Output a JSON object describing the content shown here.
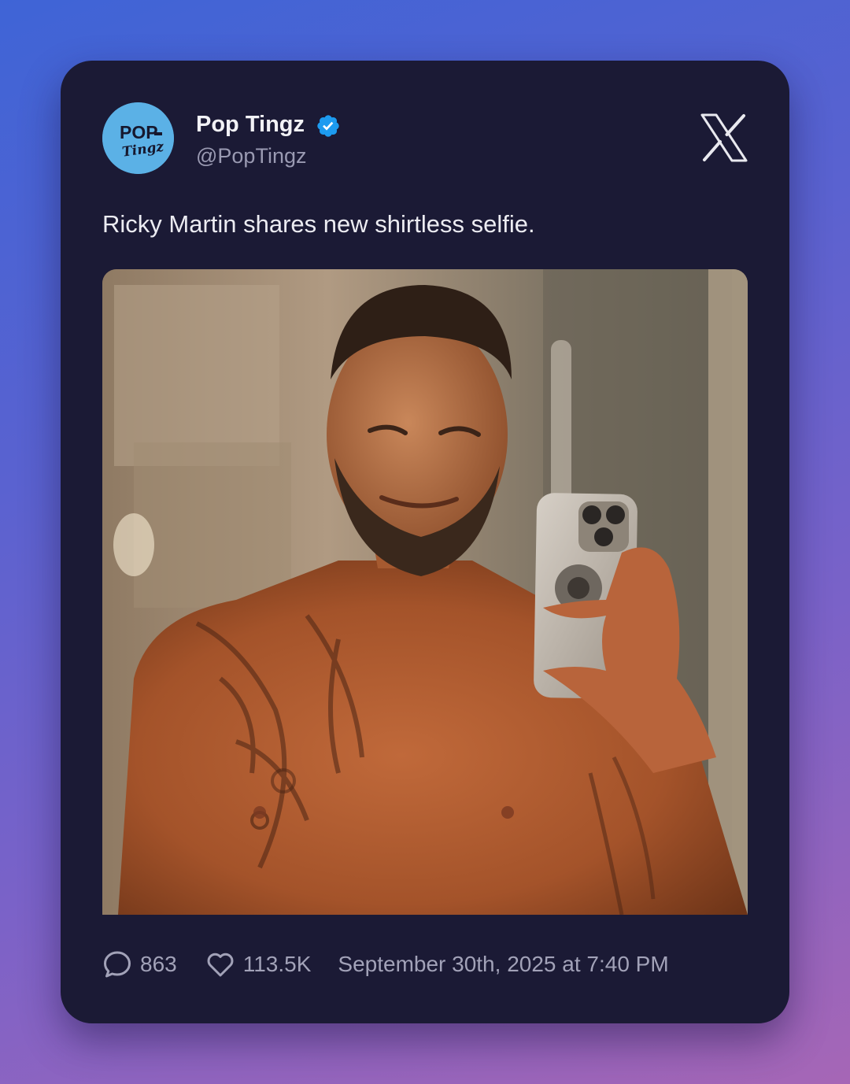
{
  "tweet": {
    "author": {
      "display_name": "Pop Tingz",
      "handle": "@PopTingz",
      "verified": true,
      "avatar": {
        "logo_text_top": "POP",
        "logo_text_bottom": "Tingz",
        "background_color": "#5bb1e6"
      }
    },
    "text": "Ricky Martin shares new shirtless selfie.",
    "media": {
      "type": "photo"
    },
    "stats": {
      "replies": "863",
      "likes": "113.5K",
      "timestamp": "September 30th, 2025 at 7:40 PM"
    },
    "platform_logo": "x-logo"
  },
  "colors": {
    "card_background": "#1b1a35",
    "text_primary": "#f2f2f6",
    "text_secondary": "#9a9ab2",
    "verified_badge": "#1d9bf0"
  },
  "icons": {
    "verified": "verified-badge-icon",
    "platform": "x-logo-icon",
    "replies": "comment-bubble-icon",
    "likes": "heart-icon"
  }
}
